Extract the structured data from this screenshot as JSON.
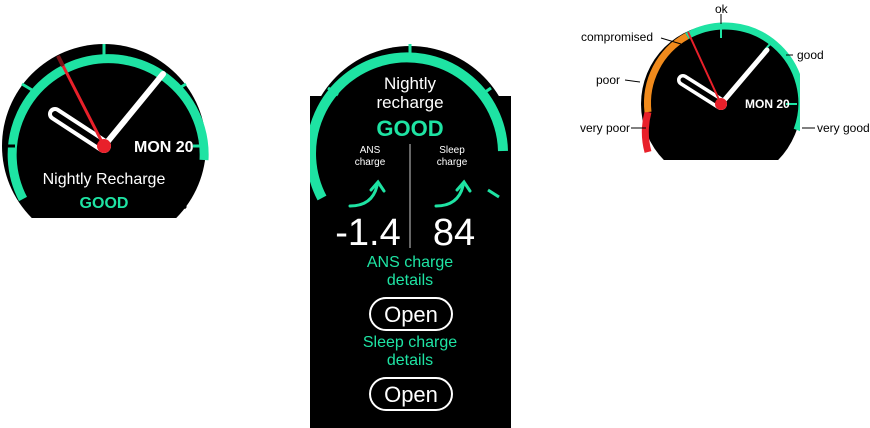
{
  "watch1": {
    "date": "MON 20",
    "title": "Nightly Recharge",
    "status": "GOOD"
  },
  "watch2": {
    "title_line1": "Nightly",
    "title_line2": "recharge",
    "status": "GOOD",
    "ans": {
      "label_line1": "ANS",
      "label_line2": "charge",
      "value": "-1.4"
    },
    "sleep": {
      "label_line1": "Sleep",
      "label_line2": "charge",
      "value": "84"
    },
    "ans_details_line1": "ANS charge",
    "ans_details_line2": "details",
    "sleep_details_line1": "Sleep charge",
    "sleep_details_line2": "details",
    "open_label": "Open"
  },
  "watch3": {
    "date": "MON 20",
    "scale": {
      "ok": "ok",
      "compromised": "compromised",
      "good": "good",
      "poor": "poor",
      "very_poor": "very poor",
      "very_good": "very good"
    }
  },
  "colors": {
    "green": "#1ee3a3",
    "red": "#e8202a",
    "orange": "#f08a1c",
    "black": "#000000"
  },
  "icons": {
    "trend_up": "arrow-up-right-icon",
    "hand_center": "red-dot-icon"
  }
}
